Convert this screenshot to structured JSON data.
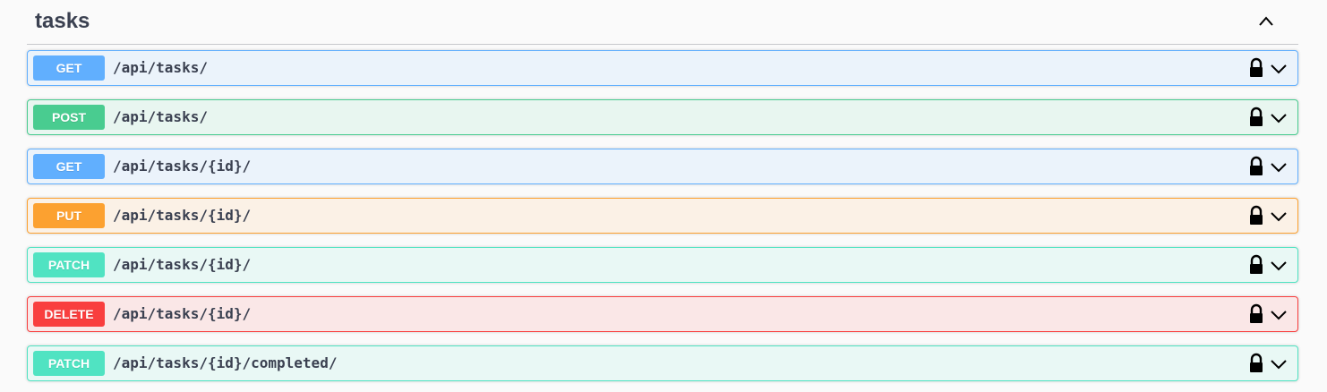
{
  "tag": {
    "title": "tasks"
  },
  "operations": [
    {
      "method": "GET",
      "path": "/api/tasks/",
      "color": "#61affe",
      "bg": "#ebf3fb"
    },
    {
      "method": "POST",
      "path": "/api/tasks/",
      "color": "#49cc90",
      "bg": "#e8f6f0"
    },
    {
      "method": "GET",
      "path": "/api/tasks/{id}/",
      "color": "#61affe",
      "bg": "#ebf3fb"
    },
    {
      "method": "PUT",
      "path": "/api/tasks/{id}/",
      "color": "#fca130",
      "bg": "#fbf1e6"
    },
    {
      "method": "PATCH",
      "path": "/api/tasks/{id}/",
      "color": "#50e3c2",
      "bg": "#e9f8f5"
    },
    {
      "method": "DELETE",
      "path": "/api/tasks/{id}/",
      "color": "#f93e3e",
      "bg": "#fae7e7"
    },
    {
      "method": "PATCH",
      "path": "/api/tasks/{id}/completed/",
      "color": "#50e3c2",
      "bg": "#e9f8f5"
    }
  ],
  "icons": {
    "collapse": "chevron-up-icon",
    "lock": "lock-icon",
    "expand": "chevron-down-icon"
  }
}
